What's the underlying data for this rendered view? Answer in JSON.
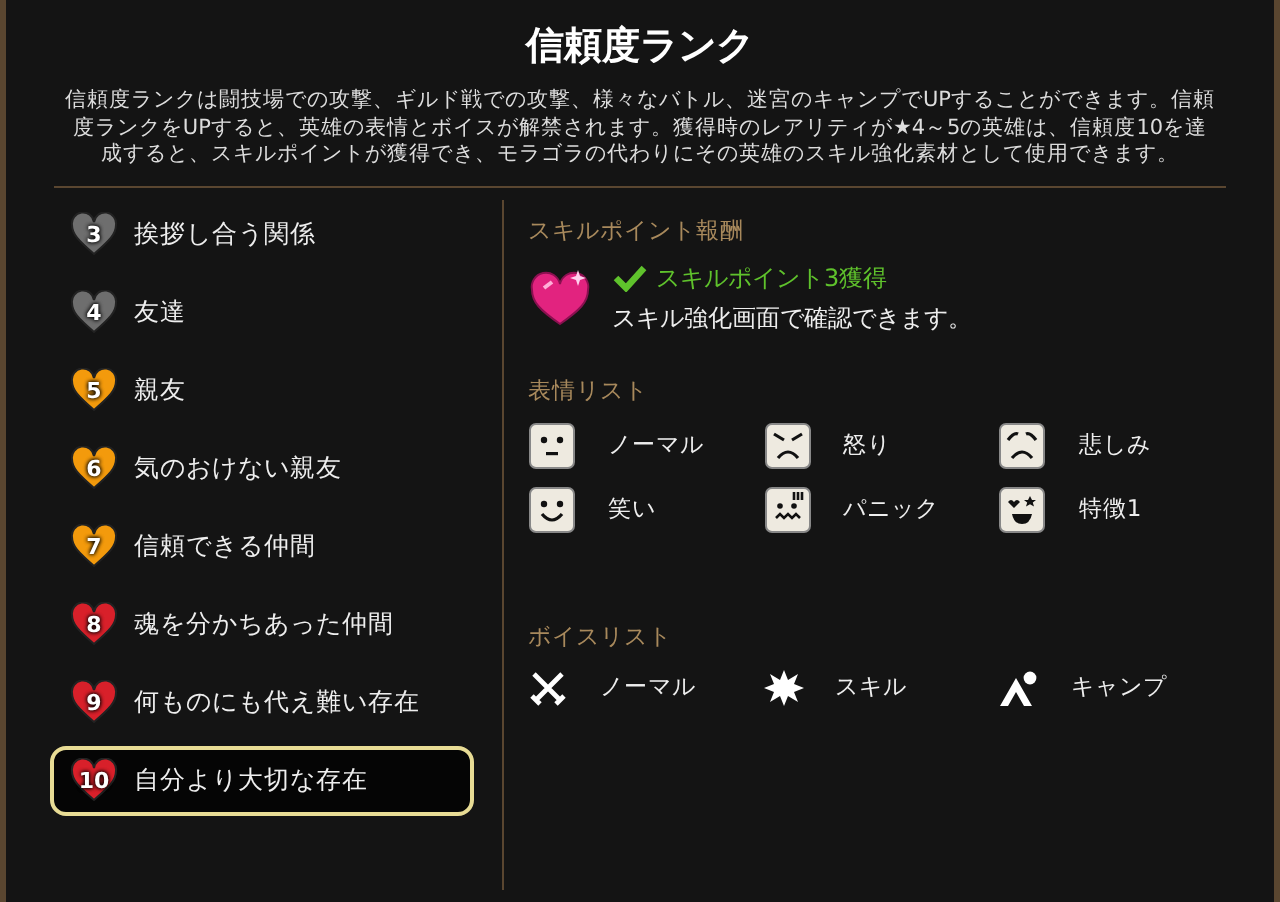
{
  "title": "信頼度ランク",
  "description": "信頼度ランクは闘技場での攻撃、ギルド戦での攻撃、様々なバトル、迷宮のキャンプでUPすることができます。信頼度ランクをUPすると、英雄の表情とボイスが解禁されます。獲得時のレアリティが★4～5の英雄は、信頼度10を達成すると、スキルポイントが獲得でき、モラゴラの代わりにその英雄のスキル強化素材として使用できます。",
  "ranks": [
    {
      "number": "3",
      "label": "挨拶し合う関係",
      "color": "#6e6e6e",
      "selected": false
    },
    {
      "number": "4",
      "label": "友達",
      "color": "#6e6e6e",
      "selected": false
    },
    {
      "number": "5",
      "label": "親友",
      "color": "#f39a0c",
      "selected": false
    },
    {
      "number": "6",
      "label": "気のおけない親友",
      "color": "#f39a0c",
      "selected": false
    },
    {
      "number": "7",
      "label": "信頼できる仲間",
      "color": "#f39a0c",
      "selected": false
    },
    {
      "number": "8",
      "label": "魂を分かちあった仲間",
      "color": "#d8202a",
      "selected": false
    },
    {
      "number": "9",
      "label": "何ものにも代え難い存在",
      "color": "#d8202a",
      "selected": false
    },
    {
      "number": "10",
      "label": "自分より大切な存在",
      "color": "#d8202a",
      "selected": true
    }
  ],
  "skill_reward": {
    "heading": "スキルポイント報酬",
    "achieved": true,
    "reward": "スキルポイント3獲得",
    "note": "スキル強化画面で確認できます。"
  },
  "expressions": {
    "heading": "表情リスト",
    "items": [
      {
        "kind": "normal",
        "label": "ノーマル"
      },
      {
        "kind": "angry",
        "label": "怒り"
      },
      {
        "kind": "sad",
        "label": "悲しみ"
      },
      {
        "kind": "smile",
        "label": "笑い"
      },
      {
        "kind": "panic",
        "label": "パニック"
      },
      {
        "kind": "star",
        "label": "特徴1"
      }
    ]
  },
  "voices": {
    "heading": "ボイスリスト",
    "items": [
      {
        "kind": "swords",
        "label": "ノーマル"
      },
      {
        "kind": "burst",
        "label": "スキル"
      },
      {
        "kind": "tent",
        "label": "キャンプ"
      }
    ]
  }
}
